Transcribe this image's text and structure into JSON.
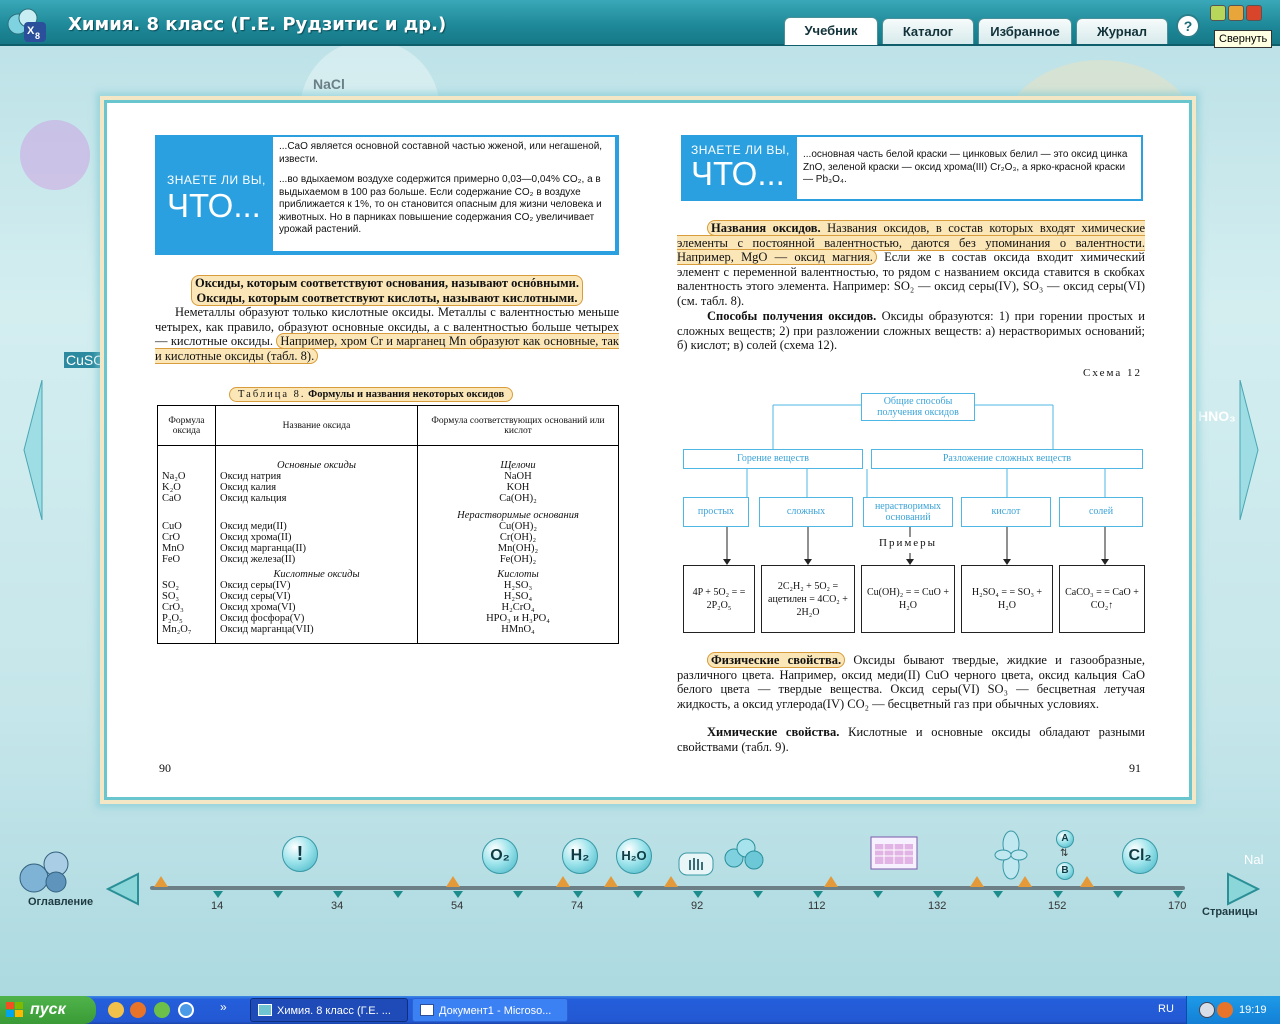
{
  "window": {
    "title": "Химия. 8 класс (Г.Е. Рудзитис и др.)",
    "tooltip": "Свернуть"
  },
  "tabs": [
    {
      "label": "Учебник"
    },
    {
      "label": "Каталог"
    },
    {
      "label": "Избранное"
    },
    {
      "label": "Журнал"
    }
  ],
  "help": "?",
  "bg_labels": {
    "nacl": "NaCl",
    "cuso": "CuSO",
    "hno3": "HNO₃",
    "nal": "Nal"
  },
  "left_page": {
    "know_q1": "ЗНАЕТЕ ЛИ ВЫ,",
    "know_q2": "ЧТО...",
    "know_text1": "...CaO является основной составной частью жженой, или негашеной, извести.",
    "know_text2": "...во вдыхаемом воздухе содержится примерно 0,03—0,04% CO₂, а в выдыхаемом в 100 раз больше. Если содержание CO₂ в воздухе приближается к 1%, то он становится опасным для жизни человека и животных. Но в парниках повышение содержания CO₂ увеличивает урожай растений.",
    "def_line1": "Оксиды, которым соответствуют основания, называют оснóвными.",
    "def_line2": "Оксиды, которым соответствуют кислоты, называют кислотными.",
    "para_start": "Неметаллы образуют только кислотные оксиды. Металлы с валентностью меньше четырех, как правило, образуют основные оксиды, а с валентностью больше четырех — кислотные оксиды.",
    "para_hl": "Например, хром Cr и марганец Mn образуют как основные, так и кислотные оксиды (табл. 8).",
    "table_caption_prefix": "Таблица 8.",
    "table_caption": "Формулы и названия некоторых оксидов",
    "col1": "Формула оксида",
    "col2": "Название оксида",
    "col3": "Формула соответствующих оснований или кислот",
    "sec_basic": "Основные оксиды",
    "sec_alk": "Щелочи",
    "sec_insol": "Нерастворимые основания",
    "sec_acidic": "Кислотные оксиды",
    "sec_acids": "Кислоты",
    "rows": [
      {
        "f": "Na₂O",
        "n": "Оксид натрия",
        "b": "NaOH"
      },
      {
        "f": "K₂O",
        "n": "Оксид калия",
        "b": "KOH"
      },
      {
        "f": "CaO",
        "n": "Оксид кальция",
        "b": "Ca(OH)₂"
      },
      {
        "f": "CuO",
        "n": "Оксид меди(II)",
        "b": "Cu(OH)₂"
      },
      {
        "f": "CrO",
        "n": "Оксид хрома(II)",
        "b": "Cr(OH)₂"
      },
      {
        "f": "MnO",
        "n": "Оксид марганца(II)",
        "b": "Mn(OH)₂"
      },
      {
        "f": "FeO",
        "n": "Оксид железа(II)",
        "b": "Fe(OH)₂"
      },
      {
        "f": "SO₂",
        "n": "Оксид серы(IV)",
        "b": "H₂SO₃"
      },
      {
        "f": "SO₃",
        "n": "Оксид серы(VI)",
        "b": "H₂SO₄"
      },
      {
        "f": "CrO₃",
        "n": "Оксид хрома(VI)",
        "b": "H₂CrO₄"
      },
      {
        "f": "P₂O₅",
        "n": "Оксид фосфора(V)",
        "b": "HPO₃ и H₃PO₄"
      },
      {
        "f": "Mn₂O₇",
        "n": "Оксид марганца(VII)",
        "b": "HMnO₄"
      }
    ],
    "page_num": "90"
  },
  "right_page": {
    "know_q1": "ЗНАЕТЕ ЛИ ВЫ,",
    "know_q2": "ЧТО...",
    "know_text": "...основная часть белой краски — цинковых белил — это оксид цинка ZnO, зеленой краски — оксид хрома(III) Cr₂O₃, а ярко-красной краски — Pb₃O₄.",
    "names_bold": "Названия оксидов.",
    "names_hl": "Названия оксидов, в состав которых входят химические элементы с постоянной валентностью, даются без упоминания о валентности. Например, MgO — оксид магния.",
    "names_rest": "Если же в состав оксида входит химический элемент с переменной валентностью, то рядом с названием оксида ставится в скобках валентность этого элемента. Например: SO₂ — оксид серы(IV), SO₃ — оксид серы(VI) (см. табл. 8).",
    "methods_bold": "Способы получения оксидов.",
    "methods_text": "Оксиды образуются: 1) при горении простых и сложных веществ; 2) при разложении сложных веществ: а) нерастворимых оснований; б) кислот; в) солей (схема 12).",
    "schema_label": "Схема 12",
    "schema_top": "Общие способы получения оксидов",
    "schema_burn": "Горение веществ",
    "schema_decomp": "Разложение сложных веществ",
    "schema_leaves": [
      "простых",
      "сложных",
      "нерастворимых оснований",
      "кислот",
      "солей"
    ],
    "examples": "Примеры",
    "eq1": "4P + 5O₂ = = 2P₂O₅",
    "eq2": "2C₂H₂ + 5O₂ = ацетилен = 4CO₂ + 2H₂O",
    "eq3": "Cu(OH)₂ = = CuO + H₂O",
    "eq4": "H₂SO₄ = = SO₃ + H₂O",
    "eq5": "CaCO₃ = = CaO + CO₂↑",
    "phys_hl": "Физические свойства.",
    "phys_text": "Оксиды бывают твердые, жидкие и газообразные, различного цвета. Например, оксид меди(II) CuO черного цвета, оксид кальция CaO белого цвета — твердые вещества. Оксид серы(VI) SO₃ — бесцветная летучая жидкость, а оксид углерода(IV) CO₂ — бесцветный газ при обычных условиях.",
    "chem_bold": "Химические свойства.",
    "chem_text": "Кислотные и основные оксиды обладают разными свойствами (табл. 9).",
    "page_num": "91"
  },
  "navigation": {
    "toc_label": "Оглавление",
    "pages_label": "Страницы",
    "ticks": [
      "14",
      "34",
      "54",
      "74",
      "92",
      "112",
      "132",
      "152",
      "170"
    ],
    "icons": {
      "excl": "!",
      "o2": "O₂",
      "h2": "H₂",
      "h2o": "H₂O",
      "cl2": "Cl₂",
      "a": "A",
      "b": "B"
    }
  },
  "taskbar": {
    "start": "пуск",
    "tasks": [
      "Химия. 8 класс (Г.Е. ...",
      "Документ1 - Microso..."
    ],
    "lang": "RU",
    "time": "19:19",
    "chevron": "»"
  }
}
